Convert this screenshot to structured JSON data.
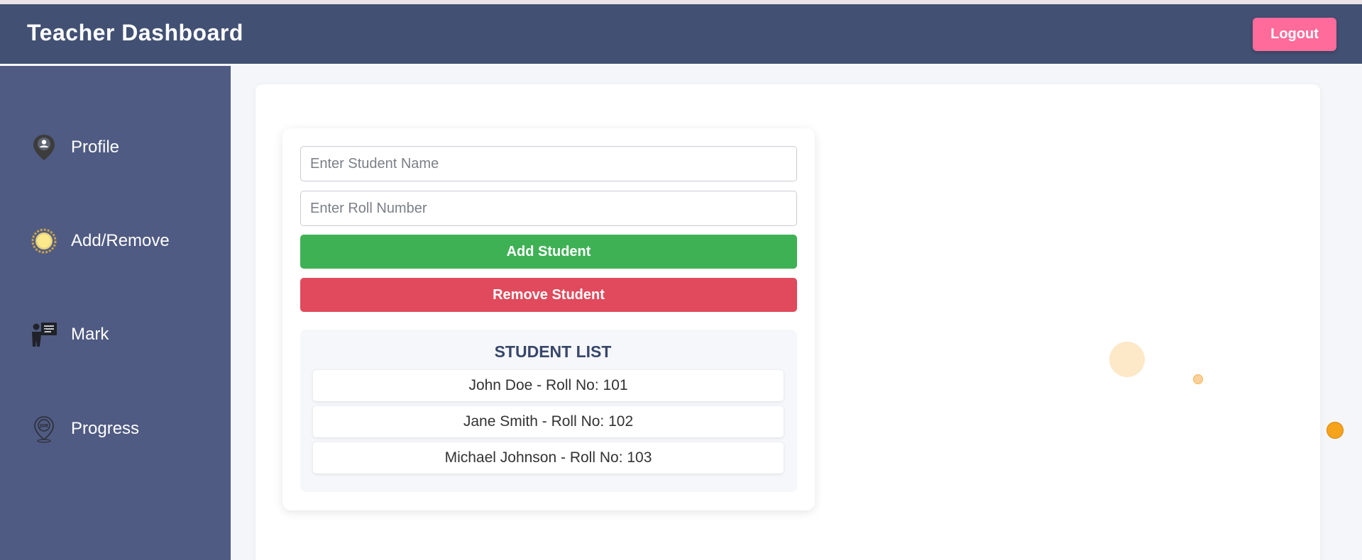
{
  "header": {
    "title": "Teacher Dashboard",
    "logout_label": "Logout"
  },
  "sidebar": {
    "items": [
      {
        "label": "Profile",
        "icon": "profile-pin-icon"
      },
      {
        "label": "Add/Remove",
        "icon": "badge-medal-icon"
      },
      {
        "label": "Mark",
        "icon": "teacher-board-icon"
      },
      {
        "label": "Progress",
        "icon": "job-pin-icon"
      }
    ]
  },
  "form": {
    "name_placeholder": "Enter Student Name",
    "roll_placeholder": "Enter Roll Number",
    "add_label": "Add Student",
    "remove_label": "Remove Student"
  },
  "student_list": {
    "title": "STUDENT LIST",
    "items": [
      "John Doe - Roll No: 101",
      "Jane Smith - Roll No: 102",
      "Michael Johnson - Roll No: 103"
    ]
  },
  "colors": {
    "header_bg": "#425073",
    "sidebar_bg": "#4f5b82",
    "logout": "#ff6b9a",
    "add": "#3fb155",
    "remove": "#e04a5c",
    "accent_orange": "#f5a623"
  }
}
